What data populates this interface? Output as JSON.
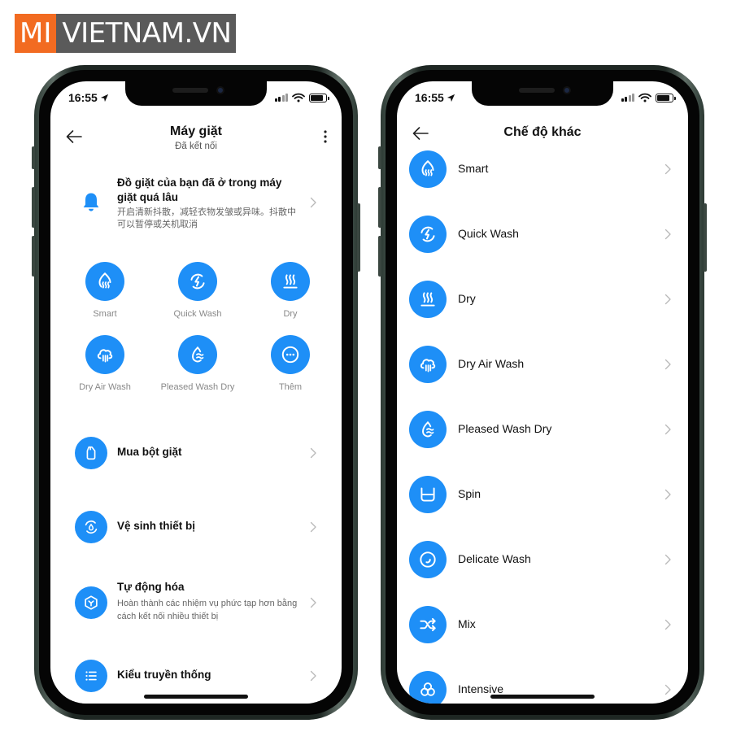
{
  "logo": {
    "part1": "MI",
    "part2": "VIETNAM.VN",
    "color1": "#f26b21",
    "color2": "#5a5a5a"
  },
  "theme": {
    "accent": "#1e8ff7"
  },
  "left_phone": {
    "status": {
      "time": "16:55",
      "signal_bars": 2,
      "signal_total": 4,
      "battery_level": 0.85
    },
    "header": {
      "title": "Máy giặt",
      "subtitle": "Đã kết nối"
    },
    "notice": {
      "icon": "bell-icon",
      "title": "Đồ giặt của bạn đã ở trong máy giặt quá lâu",
      "description": "开启清新抖散，减轻衣物发皱或异味。抖散中可以暂停或关机取消"
    },
    "modes": [
      {
        "label": "Smart",
        "icon": "smart-wash-icon"
      },
      {
        "label": "Quick Wash",
        "icon": "quick-wash-icon"
      },
      {
        "label": "Dry",
        "icon": "dry-icon"
      },
      {
        "label": "Dry Air Wash",
        "icon": "dry-air-wash-icon"
      },
      {
        "label": "Pleased Wash Dry",
        "icon": "pleased-wash-dry-icon"
      },
      {
        "label": "Thêm",
        "icon": "more-icon"
      }
    ],
    "rows": [
      {
        "title": "Mua bột giặt",
        "icon": "detergent-icon"
      },
      {
        "title": "Vệ sinh thiết bị",
        "icon": "clean-device-icon"
      },
      {
        "title": "Tự động hóa",
        "description": "Hoàn thành các nhiệm vụ phức tạp hơn bằng cách kết nối nhiều thiết bị",
        "icon": "automation-icon"
      },
      {
        "title": "Kiểu truyền thống",
        "icon": "list-icon"
      }
    ]
  },
  "right_phone": {
    "status": {
      "time": "16:55",
      "signal_bars": 2,
      "signal_total": 4,
      "battery_level": 0.85
    },
    "header": {
      "title": "Chế độ khác"
    },
    "items": [
      {
        "label": "Smart",
        "icon": "smart-wash-icon"
      },
      {
        "label": "Quick Wash",
        "icon": "quick-wash-icon"
      },
      {
        "label": "Dry",
        "icon": "dry-icon"
      },
      {
        "label": "Dry Air Wash",
        "icon": "dry-air-wash-icon"
      },
      {
        "label": "Pleased Wash Dry",
        "icon": "pleased-wash-dry-icon"
      },
      {
        "label": "Spin",
        "icon": "spin-icon"
      },
      {
        "label": "Delicate Wash",
        "icon": "delicate-wash-icon"
      },
      {
        "label": "Mix",
        "icon": "mix-icon"
      },
      {
        "label": "Intensive",
        "icon": "intensive-icon"
      }
    ]
  }
}
